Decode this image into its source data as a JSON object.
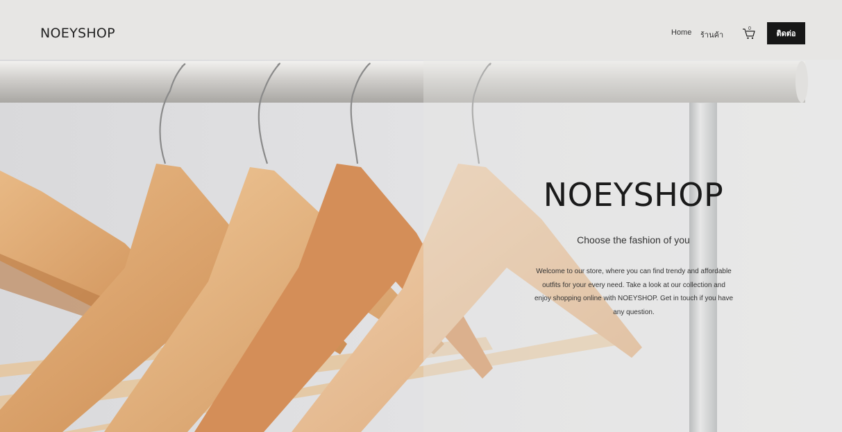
{
  "header": {
    "logo": "NOEYSHOP",
    "nav": {
      "home": "Home",
      "shop": "ร้านค้า"
    },
    "cart_count": "0",
    "contact_button": "ติดต่อ"
  },
  "hero": {
    "title": "NOEYSHOP",
    "subtitle": "Choose the fashion of you",
    "body": "Welcome to our store, where you can find trendy and affordable outfits for your every need. Take a look at our collection and enjoy shopping online with NOEYSHOP. Get in touch if you have any question."
  },
  "colors": {
    "header_bg": "#e7e6e4",
    "button_bg": "#171717",
    "text": "#1e1e1e"
  },
  "icons": {
    "cart": "cart-icon"
  }
}
